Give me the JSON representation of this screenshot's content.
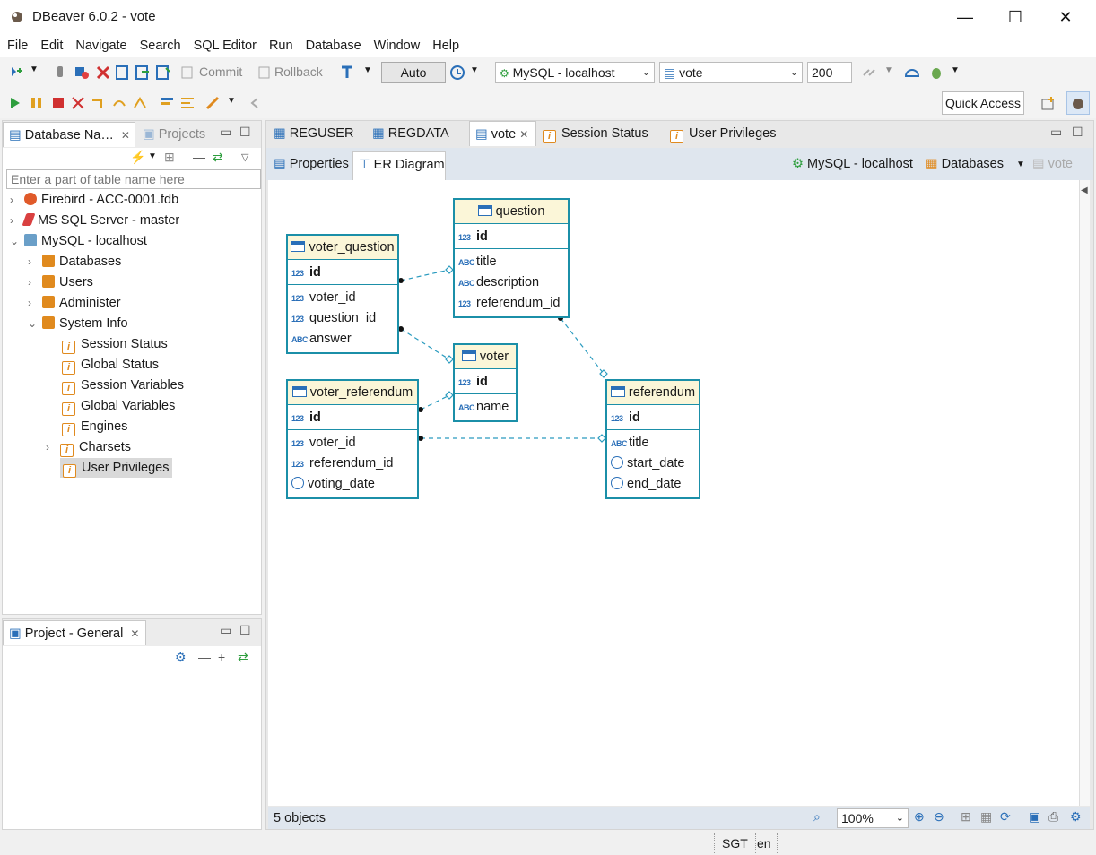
{
  "window": {
    "title": "DBeaver 6.0.2 - vote",
    "minimize": "—",
    "maximize": "☐",
    "close": "✕"
  },
  "menu": [
    "File",
    "Edit",
    "Navigate",
    "Search",
    "SQL Editor",
    "Run",
    "Database",
    "Window",
    "Help"
  ],
  "toolbar": {
    "commit": "Commit",
    "rollback": "Rollback",
    "transaction_mode": "Auto",
    "connection": "MySQL - localhost",
    "database": "vote",
    "fetch_size": "200",
    "quick_access": "Quick Access"
  },
  "navigator": {
    "tab_label": "Database Na…",
    "projects_tab": "Projects",
    "filter_placeholder": "Enter a part of table name here",
    "items": [
      {
        "label": "Firebird - ACC-0001.fdb"
      },
      {
        "label": "MS SQL Server - master"
      },
      {
        "label": "MySQL - localhost"
      },
      {
        "label": "Databases"
      },
      {
        "label": "Users"
      },
      {
        "label": "Administer"
      },
      {
        "label": "System Info"
      },
      {
        "label": "Session Status"
      },
      {
        "label": "Global Status"
      },
      {
        "label": "Session Variables"
      },
      {
        "label": "Global Variables"
      },
      {
        "label": "Engines"
      },
      {
        "label": "Charsets"
      },
      {
        "label": "User Privileges"
      }
    ]
  },
  "project_panel": {
    "tab_label": "Project - General"
  },
  "editor": {
    "tabs": [
      {
        "label": "REGUSER"
      },
      {
        "label": "REGDATA"
      },
      {
        "label": "vote"
      },
      {
        "label": "Session Status"
      },
      {
        "label": "User Privileges"
      }
    ],
    "subtabs": [
      {
        "label": "Properties"
      },
      {
        "label": "ER Diagram"
      }
    ],
    "breadcrumb": {
      "connection": "MySQL - localhost",
      "databases": "Databases",
      "db": "vote"
    }
  },
  "er": {
    "question": {
      "name": "question",
      "pk": "id",
      "cols": [
        "title",
        "description",
        "referendum_id"
      ]
    },
    "voter_question": {
      "name": "voter_question",
      "pk": "id",
      "cols": [
        "voter_id",
        "question_id",
        "answer"
      ]
    },
    "voter": {
      "name": "voter",
      "pk": "id",
      "cols": [
        "name"
      ]
    },
    "voter_referendum": {
      "name": "voter_referendum",
      "pk": "id",
      "cols": [
        "voter_id",
        "referendum_id",
        "voting_date"
      ]
    },
    "referendum": {
      "name": "referendum",
      "pk": "id",
      "cols": [
        "title",
        "start_date",
        "end_date"
      ]
    }
  },
  "diagram_status": {
    "objects": "5 objects",
    "zoom": "100%"
  },
  "status": {
    "timezone": "SGT",
    "locale": "en"
  }
}
